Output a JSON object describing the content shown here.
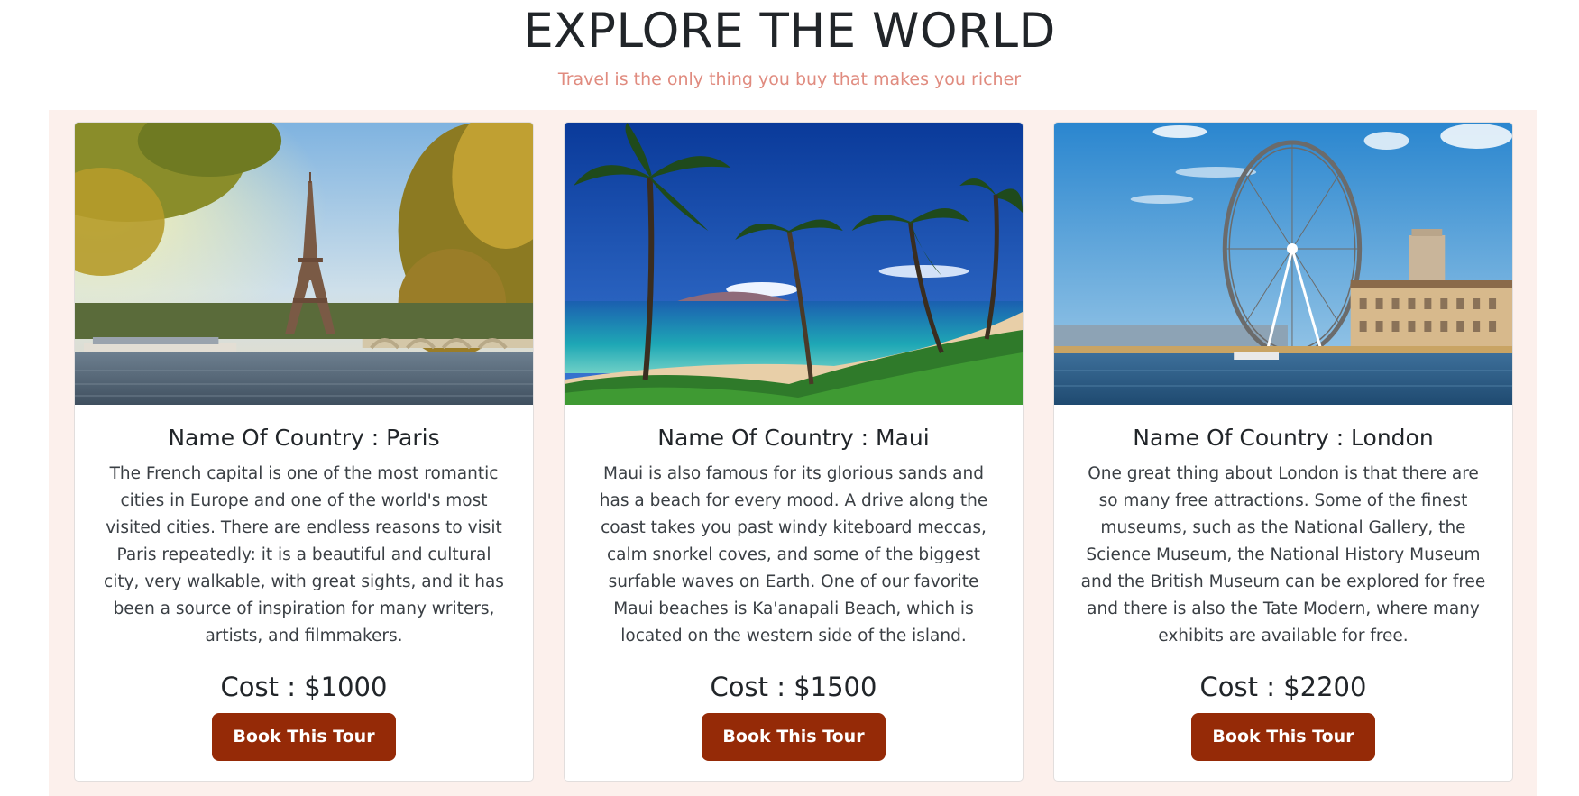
{
  "header": {
    "title": "EXPLORE THE WORLD",
    "subtitle": "Travel is the only thing you buy that makes you richer"
  },
  "cards": [
    {
      "title": "Name Of Country : Paris",
      "description": "The French capital is one of the most romantic cities in Europe and one of the world's most visited cities. There are endless reasons to visit Paris repeatedly: it is a beautiful and cultural city, very walkable, with great sights, and it has been a source of inspiration for many writers, artists, and filmmakers.",
      "cost": "Cost : $1000",
      "button_label": "Book This Tour",
      "image_icon": "eiffel-tower-photo"
    },
    {
      "title": "Name Of Country : Maui",
      "description": "Maui is also famous for its glorious sands and has a beach for every mood. A drive along the coast takes you past windy kiteboard meccas, calm snorkel coves, and some of the biggest surfable waves on Earth. One of our favorite Maui beaches is Ka'anapali Beach, which is located on the western side of the island.",
      "cost": "Cost : $1500",
      "button_label": "Book This Tour",
      "image_icon": "tropical-beach-photo"
    },
    {
      "title": "Name Of Country : London",
      "description": "One great thing about London is that there are so many free attractions. Some of the finest museums, such as the National Gallery, the Science Museum, the National History Museum and the British Museum can be explored for free and there is also the Tate Modern, where many exhibits are available for free.",
      "cost": "Cost : $2200",
      "button_label": "Book This Tour",
      "image_icon": "london-eye-photo"
    }
  ],
  "colors": {
    "accent_button": "#952a07",
    "subtitle": "#e08b7f",
    "band_background": "#fcf0ec"
  }
}
